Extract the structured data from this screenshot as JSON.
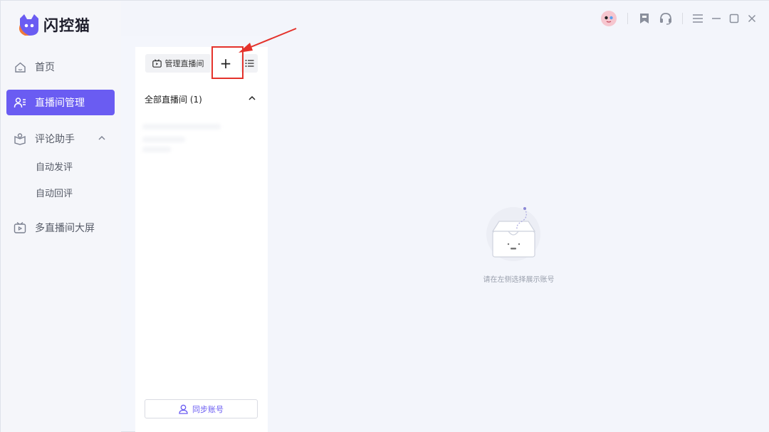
{
  "app": {
    "name": "闪控猫"
  },
  "nav": {
    "items": [
      {
        "label": "首页",
        "icon": "home-icon"
      },
      {
        "label": "直播间管理",
        "icon": "user-list-icon"
      },
      {
        "label": "评论助手",
        "icon": "comment-helper-icon"
      },
      {
        "label": "多直播间大屏",
        "icon": "tv-icon"
      }
    ],
    "sub_items": [
      {
        "label": "自动发评"
      },
      {
        "label": "自动回评"
      }
    ]
  },
  "topbar": {
    "icons": [
      "avatar-icon",
      "bookmark-icon",
      "headset-icon",
      "menu-icon",
      "minimize-icon",
      "maximize-icon",
      "close-icon"
    ]
  },
  "panel": {
    "manage_label": "管理直播间",
    "add_label": "+",
    "group_title": "全部直播间 (1)",
    "sync_label": "同步账号"
  },
  "content": {
    "empty_text": "请在左侧选择展示账号"
  },
  "colors": {
    "accent": "#6a5cf2",
    "annotation": "#e4322b"
  }
}
